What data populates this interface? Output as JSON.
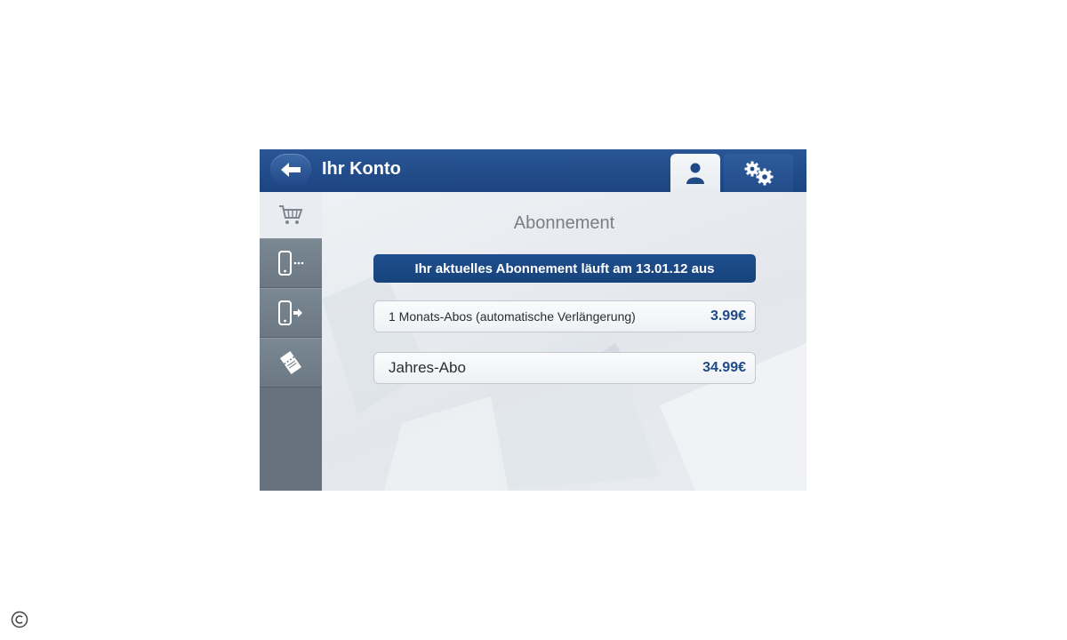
{
  "header": {
    "title": "Ihr Konto",
    "back_icon": "arrow-left-icon",
    "tabs": [
      {
        "name": "account",
        "icon": "person-icon",
        "active": true
      },
      {
        "name": "settings",
        "icon": "gears-icon",
        "active": false
      }
    ]
  },
  "sidebar": {
    "items": [
      {
        "icon": "cart-icon",
        "active": true
      },
      {
        "icon": "phone-export-icon",
        "active": false
      },
      {
        "icon": "phone-import-icon",
        "active": false
      },
      {
        "icon": "ticket-icon",
        "active": false
      }
    ]
  },
  "main": {
    "section_title": "Abonnement",
    "status_banner": "Ihr aktuelles Abonnement läuft am 13.01.12 aus",
    "options": [
      {
        "label": "1 Monats-Abos (automatische Verlängerung)",
        "price": "3.99€"
      },
      {
        "label": "Jahres-Abo",
        "price": "34.99€"
      }
    ]
  },
  "colors": {
    "header_blue": "#1c4480",
    "sidebar_gray": "#66737e",
    "price_blue": "#1f4a86",
    "content_bg": "#e9ecf0"
  }
}
